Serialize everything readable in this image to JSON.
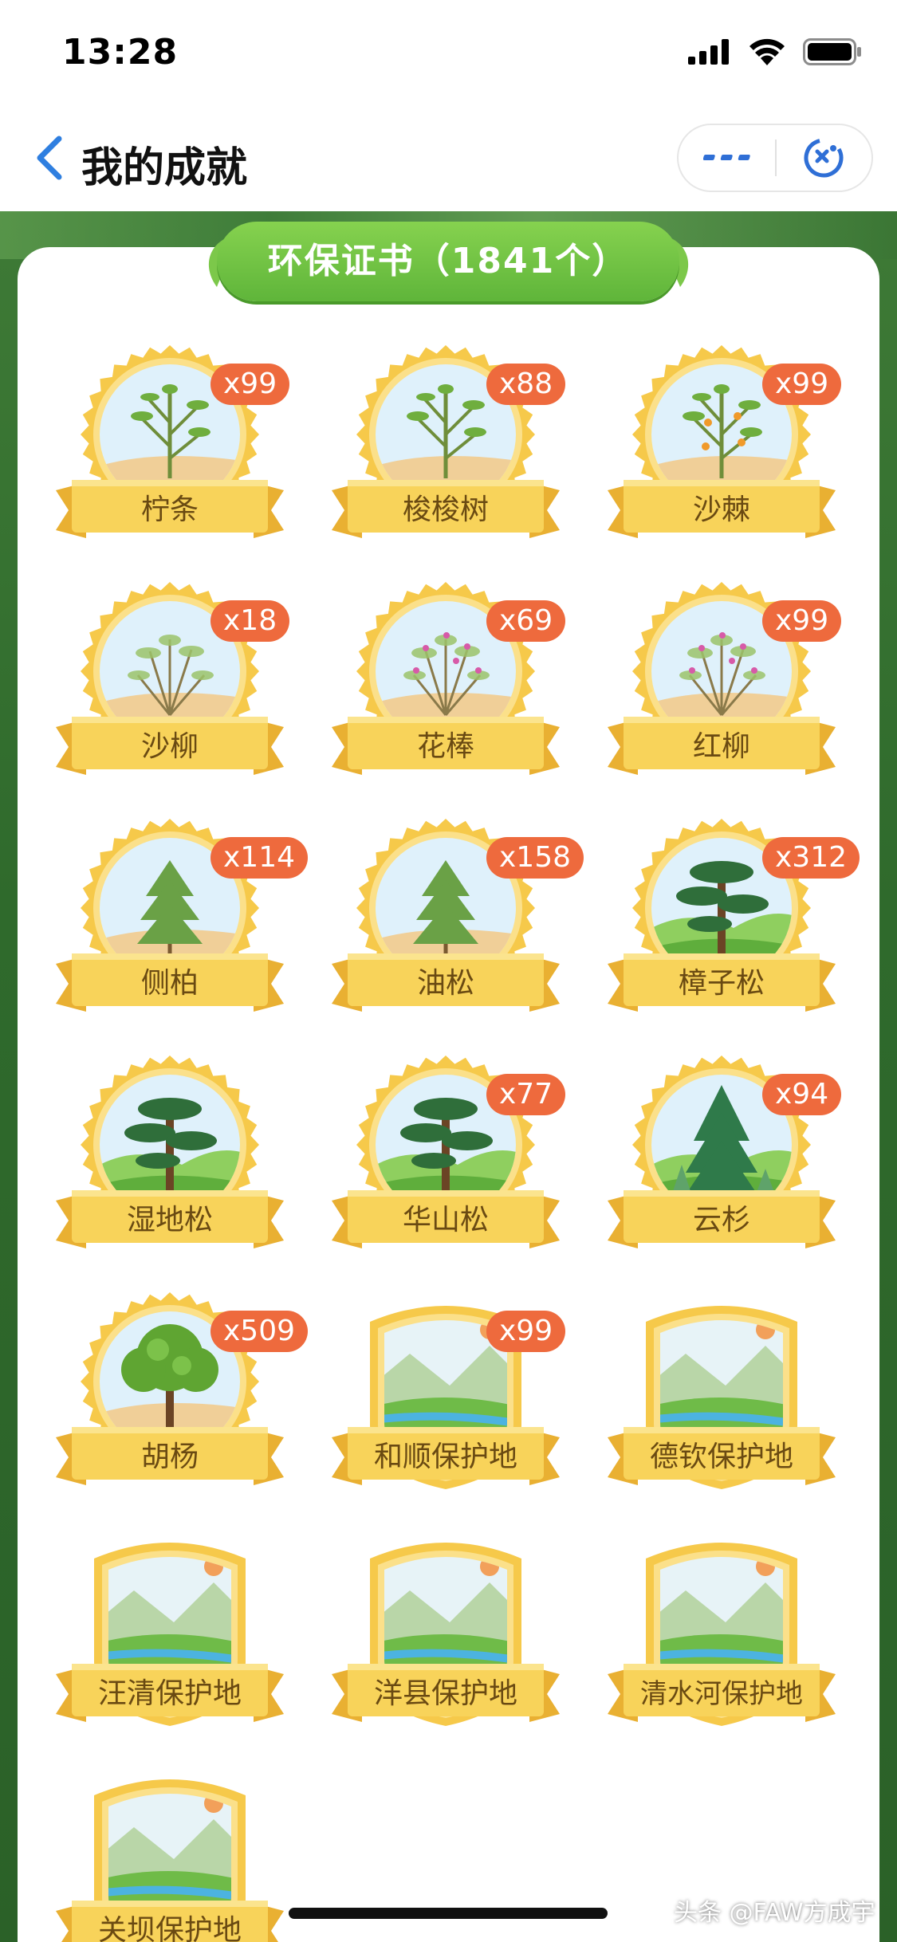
{
  "status_bar": {
    "time": "13:28"
  },
  "nav": {
    "title": "我的成就"
  },
  "banner": {
    "text": "环保证书（1841个）"
  },
  "badges": [
    {
      "name": "柠条",
      "count": "x99",
      "kind": "round",
      "scene": "desert-shrub"
    },
    {
      "name": "梭梭树",
      "count": "x88",
      "kind": "round",
      "scene": "desert-shrub"
    },
    {
      "name": "沙棘",
      "count": "x99",
      "kind": "round",
      "scene": "berry-shrub"
    },
    {
      "name": "沙柳",
      "count": "x18",
      "kind": "round",
      "scene": "bush"
    },
    {
      "name": "花棒",
      "count": "x69",
      "kind": "round",
      "scene": "flower-bush"
    },
    {
      "name": "红柳",
      "count": "x99",
      "kind": "round",
      "scene": "flower-bush"
    },
    {
      "name": "侧柏",
      "count": "x114",
      "kind": "round",
      "scene": "conifer"
    },
    {
      "name": "油松",
      "count": "x158",
      "kind": "round",
      "scene": "conifer"
    },
    {
      "name": "樟子松",
      "count": "x312",
      "kind": "round",
      "scene": "pine"
    },
    {
      "name": "湿地松",
      "count": "",
      "kind": "round",
      "scene": "pine"
    },
    {
      "name": "华山松",
      "count": "x77",
      "kind": "round",
      "scene": "pine"
    },
    {
      "name": "云杉",
      "count": "x94",
      "kind": "round",
      "scene": "spruce"
    },
    {
      "name": "胡杨",
      "count": "x509",
      "kind": "round",
      "scene": "poplar"
    },
    {
      "name": "和顺保护地",
      "count": "x99",
      "kind": "shield",
      "scene": "reserve"
    },
    {
      "name": "德钦保护地",
      "count": "",
      "kind": "shield",
      "scene": "reserve"
    },
    {
      "name": "汪清保护地",
      "count": "",
      "kind": "shield",
      "scene": "reserve"
    },
    {
      "name": "洋县保护地",
      "count": "",
      "kind": "shield",
      "scene": "reserve"
    },
    {
      "name": "清水河保护地",
      "count": "",
      "kind": "shield",
      "scene": "reserve"
    },
    {
      "name": "关坝保护地",
      "count": "",
      "kind": "shield",
      "scene": "reserve"
    }
  ],
  "watermark": "头条 @FAW方成宇",
  "colors": {
    "badge_gold": "#f6c94a",
    "ribbon": "#f8d35a",
    "count_bg": "#ee6a3d",
    "banner_green": "#6cc142"
  }
}
